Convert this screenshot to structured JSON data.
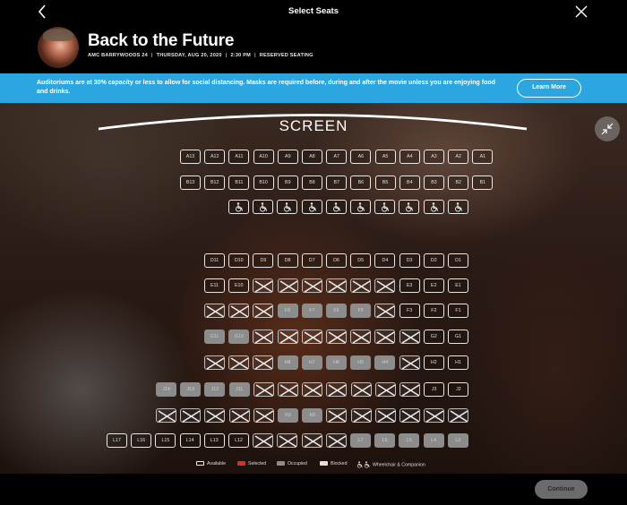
{
  "header": {
    "title": "Select Seats",
    "back_icon": "chevron-left-icon",
    "close_icon": "close-icon"
  },
  "movie": {
    "title": "Back to the Future",
    "theater": "AMC BARRYWOODS 24",
    "date": "THURSDAY, AUG 20, 2020",
    "time": "2:30 PM",
    "seating": "RESERVED SEATING",
    "separator": "|"
  },
  "banner": {
    "text": "Auditoriums are at 30% capacity or less to allow for social distancing. Masks are required before, during and after the movie unless you are enjoying food and drinks.",
    "button_label": "Learn More",
    "color": "#2ba6e0"
  },
  "screen_label": "SCREEN",
  "rows": [
    {
      "seats": [
        {
          "id": "A13",
          "s": "available"
        },
        {
          "id": "A12",
          "s": "available"
        },
        {
          "id": "A11",
          "s": "available"
        },
        {
          "id": "A10",
          "s": "available"
        },
        {
          "id": "A9",
          "s": "available"
        },
        {
          "id": "A8",
          "s": "available"
        },
        {
          "id": "A7",
          "s": "available"
        },
        {
          "id": "A6",
          "s": "available"
        },
        {
          "id": "A5",
          "s": "available"
        },
        {
          "id": "A4",
          "s": "available"
        },
        {
          "id": "A3",
          "s": "available"
        },
        {
          "id": "A2",
          "s": "available"
        },
        {
          "id": "A1",
          "s": "available"
        }
      ]
    },
    {
      "seats": [
        {
          "id": "B13",
          "s": "available"
        },
        {
          "id": "B12",
          "s": "available"
        },
        {
          "id": "B11",
          "s": "available"
        },
        {
          "id": "B10",
          "s": "available"
        },
        {
          "id": "B9",
          "s": "available"
        },
        {
          "id": "B8",
          "s": "available"
        },
        {
          "id": "B7",
          "s": "available"
        },
        {
          "id": "B6",
          "s": "available"
        },
        {
          "id": "B5",
          "s": "available"
        },
        {
          "id": "B4",
          "s": "available"
        },
        {
          "id": "B3",
          "s": "available"
        },
        {
          "id": "B2",
          "s": "available"
        },
        {
          "id": "B1",
          "s": "available"
        }
      ]
    },
    {
      "seats": [
        {
          "id": "",
          "s": "wheel"
        },
        {
          "id": "",
          "s": "wheel"
        },
        {
          "id": "",
          "s": "wheel"
        },
        {
          "id": "",
          "s": "wheel"
        },
        {
          "id": "",
          "s": "wheel"
        },
        {
          "id": "",
          "s": "wheel"
        },
        {
          "id": "",
          "s": "wheel"
        },
        {
          "id": "",
          "s": "wheel"
        },
        {
          "id": "",
          "s": "wheel"
        },
        {
          "id": "",
          "s": "wheel"
        }
      ]
    },
    {
      "seats": [
        {
          "id": "D11",
          "s": "available"
        },
        {
          "id": "D10",
          "s": "available"
        },
        {
          "id": "D9",
          "s": "available"
        },
        {
          "id": "D8",
          "s": "available"
        },
        {
          "id": "D7",
          "s": "available"
        },
        {
          "id": "D6",
          "s": "available"
        },
        {
          "id": "D5",
          "s": "available"
        },
        {
          "id": "D4",
          "s": "available"
        },
        {
          "id": "D3",
          "s": "available"
        },
        {
          "id": "D2",
          "s": "available"
        },
        {
          "id": "D1",
          "s": "available"
        }
      ]
    },
    {
      "seats": [
        {
          "id": "E11",
          "s": "available"
        },
        {
          "id": "E10",
          "s": "available"
        },
        {
          "id": "",
          "s": "blocked"
        },
        {
          "id": "",
          "s": "blocked"
        },
        {
          "id": "",
          "s": "blocked"
        },
        {
          "id": "",
          "s": "blocked"
        },
        {
          "id": "",
          "s": "blocked"
        },
        {
          "id": "",
          "s": "blocked"
        },
        {
          "id": "E3",
          "s": "available"
        },
        {
          "id": "E2",
          "s": "available"
        },
        {
          "id": "E1",
          "s": "available"
        }
      ]
    },
    {
      "seats": [
        {
          "id": "",
          "s": "blocked"
        },
        {
          "id": "",
          "s": "blocked"
        },
        {
          "id": "",
          "s": "blocked"
        },
        {
          "id": "F8",
          "s": "occupied"
        },
        {
          "id": "F7",
          "s": "occupied"
        },
        {
          "id": "F6",
          "s": "occupied"
        },
        {
          "id": "F5",
          "s": "occupied"
        },
        {
          "id": "",
          "s": "blocked"
        },
        {
          "id": "F3",
          "s": "available"
        },
        {
          "id": "F2",
          "s": "available"
        },
        {
          "id": "F1",
          "s": "available"
        }
      ]
    },
    {
      "seats": [
        {
          "id": "G11",
          "s": "occupied"
        },
        {
          "id": "G10",
          "s": "occupied"
        },
        {
          "id": "",
          "s": "blocked"
        },
        {
          "id": "",
          "s": "blocked"
        },
        {
          "id": "",
          "s": "blocked"
        },
        {
          "id": "",
          "s": "blocked"
        },
        {
          "id": "",
          "s": "blocked"
        },
        {
          "id": "",
          "s": "blocked"
        },
        {
          "id": "",
          "s": "blocked"
        },
        {
          "id": "G2",
          "s": "available"
        },
        {
          "id": "G1",
          "s": "available"
        }
      ]
    },
    {
      "seats": [
        {
          "id": "",
          "s": "blocked"
        },
        {
          "id": "",
          "s": "blocked"
        },
        {
          "id": "",
          "s": "blocked"
        },
        {
          "id": "H8",
          "s": "occupied"
        },
        {
          "id": "H7",
          "s": "occupied"
        },
        {
          "id": "H6",
          "s": "occupied"
        },
        {
          "id": "H5",
          "s": "occupied"
        },
        {
          "id": "H4",
          "s": "occupied"
        },
        {
          "id": "",
          "s": "blocked"
        },
        {
          "id": "H2",
          "s": "available"
        },
        {
          "id": "H1",
          "s": "available"
        }
      ]
    },
    {
      "seats": [
        {
          "id": "J14",
          "s": "occupied"
        },
        {
          "id": "J13",
          "s": "occupied"
        },
        {
          "id": "J12",
          "s": "occupied"
        },
        {
          "id": "J11",
          "s": "occupied"
        },
        {
          "id": "",
          "s": "blocked"
        },
        {
          "id": "",
          "s": "blocked"
        },
        {
          "id": "",
          "s": "blocked"
        },
        {
          "id": "",
          "s": "blocked"
        },
        {
          "id": "",
          "s": "blocked"
        },
        {
          "id": "",
          "s": "blocked"
        },
        {
          "id": "",
          "s": "blocked"
        },
        {
          "id": "J3",
          "s": "available"
        },
        {
          "id": "J2",
          "s": "available"
        }
      ]
    },
    {
      "seats": [
        {
          "id": "",
          "s": "blocked"
        },
        {
          "id": "",
          "s": "blocked"
        },
        {
          "id": "",
          "s": "blocked"
        },
        {
          "id": "",
          "s": "blocked"
        },
        {
          "id": "",
          "s": "blocked"
        },
        {
          "id": "K9",
          "s": "occupied"
        },
        {
          "id": "K8",
          "s": "occupied"
        },
        {
          "id": "",
          "s": "blocked"
        },
        {
          "id": "",
          "s": "blocked"
        },
        {
          "id": "",
          "s": "blocked"
        },
        {
          "id": "",
          "s": "blocked"
        },
        {
          "id": "",
          "s": "blocked"
        },
        {
          "id": "",
          "s": "blocked"
        }
      ]
    },
    {
      "seats": [
        {
          "id": "L17",
          "s": "available"
        },
        {
          "id": "L16",
          "s": "available"
        },
        {
          "id": "L15",
          "s": "available"
        },
        {
          "id": "L14",
          "s": "available"
        },
        {
          "id": "L13",
          "s": "available"
        },
        {
          "id": "L12",
          "s": "available"
        },
        {
          "id": "",
          "s": "blocked"
        },
        {
          "id": "",
          "s": "blocked"
        },
        {
          "id": "",
          "s": "blocked"
        },
        {
          "id": "",
          "s": "blocked"
        },
        {
          "id": "L7",
          "s": "occupied"
        },
        {
          "id": "L6",
          "s": "occupied"
        },
        {
          "id": "L5",
          "s": "occupied"
        },
        {
          "id": "L4",
          "s": "occupied"
        },
        {
          "id": "L3",
          "s": "occupied"
        }
      ]
    }
  ],
  "legend": {
    "available": "Available",
    "selected": "Selected",
    "occupied": "Occupied",
    "blocked": "Blocked",
    "wheelchair": "Wheelchair & Companion",
    "selected_color": "#d0312d"
  },
  "footer": {
    "continue_label": "Continue"
  }
}
